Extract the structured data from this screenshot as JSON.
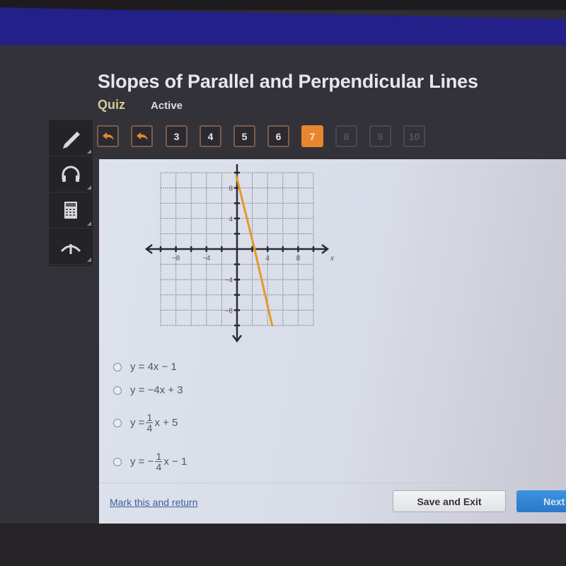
{
  "header": {
    "title": "Slopes of Parallel and Perpendicular Lines",
    "type_label": "Quiz",
    "status_label": "Active"
  },
  "navigation": {
    "back_buttons": [
      "back-arrow",
      "back-arrow"
    ],
    "questions": [
      {
        "label": "3",
        "state": "visited"
      },
      {
        "label": "4",
        "state": "visited"
      },
      {
        "label": "5",
        "state": "visited"
      },
      {
        "label": "6",
        "state": "visited"
      },
      {
        "label": "7",
        "state": "current"
      },
      {
        "label": "8",
        "state": "disabled"
      },
      {
        "label": "9",
        "state": "disabled"
      },
      {
        "label": "10",
        "state": "disabled"
      }
    ],
    "accent_color": "#e8862e"
  },
  "toolbar": {
    "tools": [
      {
        "name": "pencil-icon"
      },
      {
        "name": "headphones-icon"
      },
      {
        "name": "calculator-icon"
      },
      {
        "name": "collapse-arrow-icon"
      }
    ]
  },
  "chart_data": {
    "type": "line",
    "title": "",
    "xlabel": "x",
    "ylabel": "",
    "xlim": [
      -10,
      10
    ],
    "ylim": [
      -10,
      10
    ],
    "grid": true,
    "grid_step": 2,
    "x_tick_labels": [
      "-8",
      "-4",
      "4",
      "8"
    ],
    "y_tick_labels": [
      "8",
      "4",
      "-4",
      "-8"
    ],
    "series": [
      {
        "name": "graphed line",
        "color": "#e8962e",
        "points": [
          [
            -0.1,
            9.6
          ],
          [
            2.3,
            0
          ],
          [
            4.6,
            -10
          ]
        ]
      }
    ]
  },
  "question": {
    "choices": [
      {
        "id": "a",
        "parts": [
          "y = 4x − 1"
        ]
      },
      {
        "id": "b",
        "parts": [
          "y = −4x + 3"
        ]
      },
      {
        "id": "c",
        "prefix": "y = ",
        "frac_num": "1",
        "frac_den": "4",
        "suffix": "x + 5"
      },
      {
        "id": "d",
        "prefix": "y = −",
        "frac_num": "1",
        "frac_den": "4",
        "suffix": "x − 1"
      }
    ]
  },
  "footer": {
    "mark_link": "Mark this and return",
    "save_exit": "Save and Exit",
    "next": "Next"
  }
}
